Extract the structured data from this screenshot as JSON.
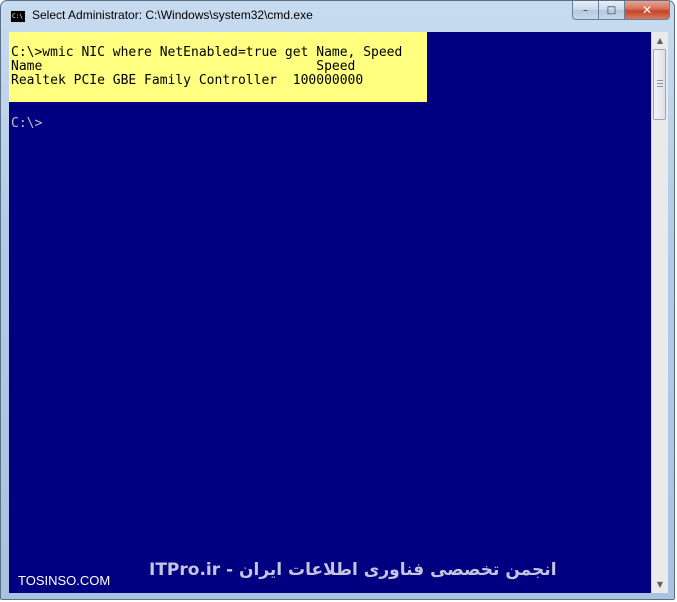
{
  "window": {
    "title": "Select Administrator: C:\\Windows\\system32\\cmd.exe",
    "icon": "cmd-icon",
    "icon_text": "C:\\"
  },
  "caption_buttons": {
    "minimize": "–",
    "maximize": "□",
    "close": "✕"
  },
  "console": {
    "background_color": "#000080",
    "text_color": "#c0c0c0",
    "highlight_color": "#ffff80",
    "lines": [
      "C:\\>wmic NIC where NetEnabled=true get Name, Speed",
      "Name                                   Speed",
      "Realtek PCIe GBE Family Controller  100000000",
      "C:\\>"
    ]
  },
  "watermarks": {
    "left": "TOSINSO.COM",
    "right": "ITPro.ir - انجمن تخصصی فناوری اطلاعات ایران"
  },
  "scrollbar": {
    "up_arrow": "▲",
    "down_arrow": "▼"
  }
}
